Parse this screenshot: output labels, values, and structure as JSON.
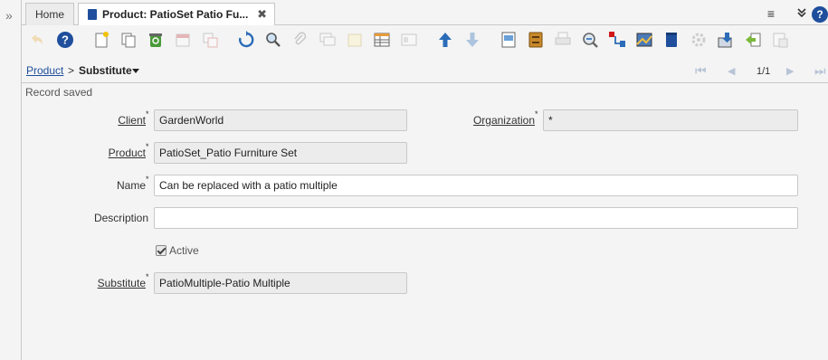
{
  "tabs": [
    {
      "label": "Home"
    },
    {
      "label": "Product: PatioSet Patio Fu..."
    }
  ],
  "tab_close_glyph": "✖",
  "tabbar_icons": [
    "menu-icon",
    "chevron-double-down-icon",
    "help-icon"
  ],
  "help_glyph": "?",
  "toolbar": {
    "buttons": [
      {
        "name": "undo-icon",
        "enabled": false
      },
      {
        "name": "help-icon",
        "enabled": true
      },
      {
        "name": "new-record-icon",
        "enabled": true
      },
      {
        "name": "copy-record-icon",
        "enabled": true
      },
      {
        "name": "delete-record-icon",
        "enabled": true
      },
      {
        "name": "delete-selection-icon",
        "enabled": false
      },
      {
        "name": "save-icon",
        "enabled": false
      },
      {
        "name": "refresh-icon",
        "enabled": true
      },
      {
        "name": "find-icon",
        "enabled": true
      },
      {
        "name": "attachment-icon",
        "enabled": false
      },
      {
        "name": "chat-icon",
        "enabled": false
      },
      {
        "name": "note-icon",
        "enabled": false
      },
      {
        "name": "grid-toggle-icon",
        "enabled": true
      },
      {
        "name": "multi-view-icon",
        "enabled": false
      },
      {
        "name": "parent-record-icon",
        "enabled": true
      },
      {
        "name": "detail-record-icon",
        "enabled": false
      },
      {
        "name": "report-icon",
        "enabled": true
      },
      {
        "name": "archive-icon",
        "enabled": true
      },
      {
        "name": "print-icon",
        "enabled": false
      },
      {
        "name": "zoom-across-icon",
        "enabled": true
      },
      {
        "name": "requests-icon",
        "enabled": true
      },
      {
        "name": "product-info-icon",
        "enabled": true
      },
      {
        "name": "workflow-icon",
        "enabled": true
      },
      {
        "name": "process-icon",
        "enabled": false
      },
      {
        "name": "export-icon",
        "enabled": true
      },
      {
        "name": "import-icon",
        "enabled": true
      },
      {
        "name": "post-icon",
        "enabled": false
      }
    ]
  },
  "breadcrumb": {
    "parent": "Product",
    "separator": ">",
    "current": "Substitute"
  },
  "navigation": {
    "record_counter": "1/1",
    "first_glyph": "⏮",
    "prev_glyph": "◀",
    "next_glyph": "▶",
    "last_glyph": "⏭"
  },
  "status_message": "Record saved",
  "form": {
    "client_label": "Client",
    "client_value": "GardenWorld",
    "organization_label": "Organization",
    "organization_value": "*",
    "product_label": "Product",
    "product_value": "PatioSet_Patio Furniture Set",
    "name_label": "Name",
    "name_value": "Can be replaced with a patio multiple",
    "description_label": "Description",
    "description_value": "",
    "active_label": "Active",
    "active_checked": true,
    "substitute_label": "Substitute",
    "substitute_value": "PatioMultiple-Patio Multiple",
    "required_mark": "*"
  },
  "colors": {
    "accent": "#1f4f9c",
    "readonly_field_bg": "#ececec",
    "editable_field_bg": "#ffffff"
  }
}
